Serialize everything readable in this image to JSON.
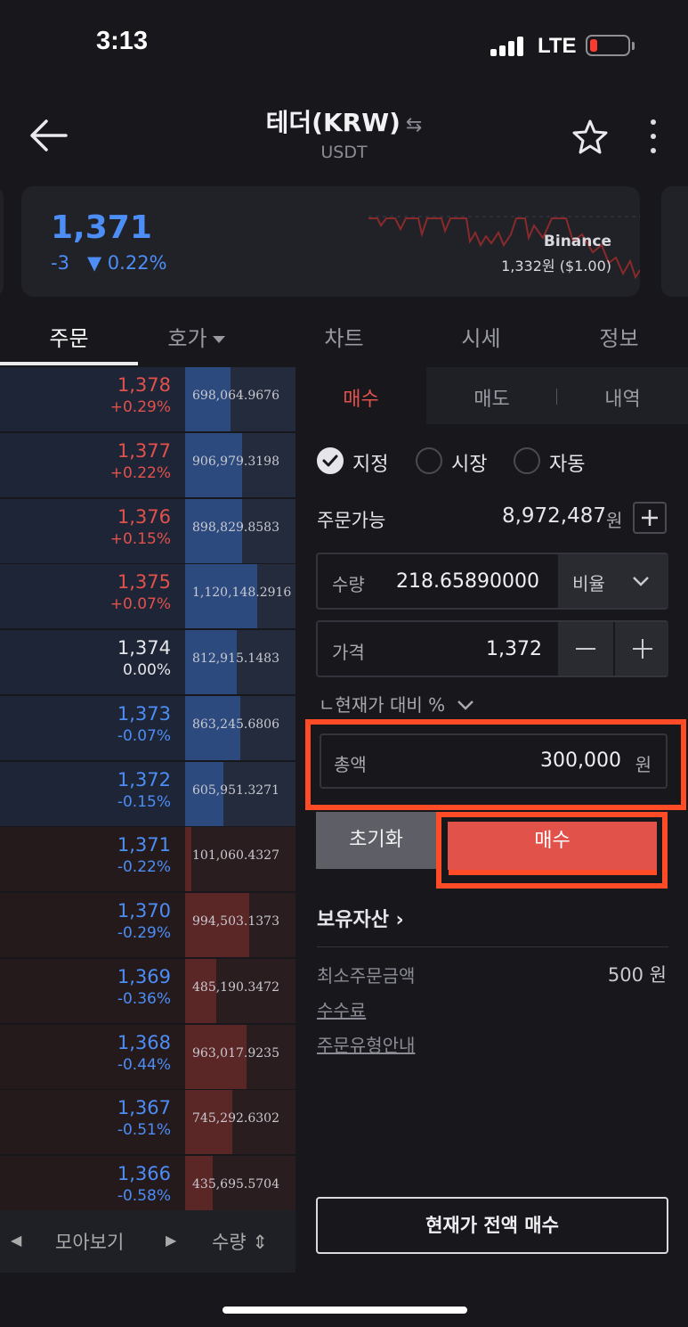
{
  "status_bar": {
    "time": "3:13",
    "network": "LTE"
  },
  "header": {
    "title": "테더(KRW)",
    "swap_glyph": "⇆",
    "subtitle": "USDT"
  },
  "ticker": {
    "price": "1,371",
    "change": "-3",
    "change_pct": "▼ 0.22%",
    "reference_exchange": "Binance",
    "reference_price": "1,332원 ($1.00)"
  },
  "tabs": [
    {
      "label": "주문",
      "active": true
    },
    {
      "label": "호가",
      "has_dropdown": true
    },
    {
      "label": "차트"
    },
    {
      "label": "시세"
    },
    {
      "label": "정보"
    }
  ],
  "order_book": {
    "rows": [
      {
        "price": "1,378",
        "pct": "+0.29%",
        "qty": "698,064.9676",
        "side": "ask",
        "tone": "red",
        "fill": 0.41
      },
      {
        "price": "1,377",
        "pct": "+0.22%",
        "qty": "906,979.3198",
        "side": "ask",
        "tone": "red",
        "fill": 0.52
      },
      {
        "price": "1,376",
        "pct": "+0.15%",
        "qty": "898,829.8583",
        "side": "ask",
        "tone": "red",
        "fill": 0.52
      },
      {
        "price": "1,375",
        "pct": "+0.07%",
        "qty": "1,120,148.2916",
        "side": "ask",
        "tone": "red",
        "fill": 0.65
      },
      {
        "price": "1,374",
        "pct": "0.00%",
        "qty": "812,915.1483",
        "side": "ask",
        "tone": "white",
        "fill": 0.47
      },
      {
        "price": "1,373",
        "pct": "-0.07%",
        "qty": "863,245.6806",
        "side": "ask",
        "tone": "blue",
        "fill": 0.5
      },
      {
        "price": "1,372",
        "pct": "-0.15%",
        "qty": "605,951.3271",
        "side": "ask",
        "tone": "blue",
        "fill": 0.35
      },
      {
        "price": "1,371",
        "pct": "-0.22%",
        "qty": "101,060.4327",
        "side": "bid",
        "tone": "blue",
        "fill": 0.06,
        "current": true
      },
      {
        "price": "1,370",
        "pct": "-0.29%",
        "qty": "994,503.1373",
        "side": "bid",
        "tone": "blue",
        "fill": 0.58
      },
      {
        "price": "1,369",
        "pct": "-0.36%",
        "qty": "485,190.3472",
        "side": "bid",
        "tone": "blue",
        "fill": 0.28
      },
      {
        "price": "1,368",
        "pct": "-0.44%",
        "qty": "963,017.9235",
        "side": "bid",
        "tone": "blue",
        "fill": 0.56
      },
      {
        "price": "1,367",
        "pct": "-0.51%",
        "qty": "745,292.6302",
        "side": "bid",
        "tone": "blue",
        "fill": 0.43
      },
      {
        "price": "1,366",
        "pct": "-0.58%",
        "qty": "435,695.5704",
        "side": "bid",
        "tone": "blue",
        "fill": 0.25
      }
    ],
    "footer": {
      "left_arrow": "◀",
      "group_label": "모아보기",
      "right_arrow": "▶",
      "qty_label": "수량 ⇕"
    }
  },
  "order_panel": {
    "tabs": [
      {
        "label": "매수",
        "active": true
      },
      {
        "label": "매도"
      },
      {
        "label": "내역"
      }
    ],
    "order_types": [
      {
        "label": "지정",
        "selected": true
      },
      {
        "label": "시장"
      },
      {
        "label": "자동"
      }
    ],
    "available": {
      "label": "주문가능",
      "value": "8,972,487",
      "unit": "원"
    },
    "quantity": {
      "label": "수량",
      "value": "218.65890000",
      "ratio_label": "비율"
    },
    "price": {
      "label": "가격",
      "value": "1,372"
    },
    "compare_label": "ㄴ현재가 대비 %",
    "total": {
      "label": "총액",
      "value": "300,000",
      "unit": "원"
    },
    "reset_label": "초기화",
    "buy_label": "매수",
    "holdings_label": "보유자산 ›",
    "min_order": {
      "label": "최소주문금액",
      "value": "500 원"
    },
    "links": [
      "수수료",
      "주문유형안내"
    ],
    "full_buy_label": "현재가 전액 매수"
  },
  "colors": {
    "rise": "#e2514c",
    "fall": "#4c8df6",
    "highlight": "#ff4b26",
    "background": "#17171c"
  }
}
